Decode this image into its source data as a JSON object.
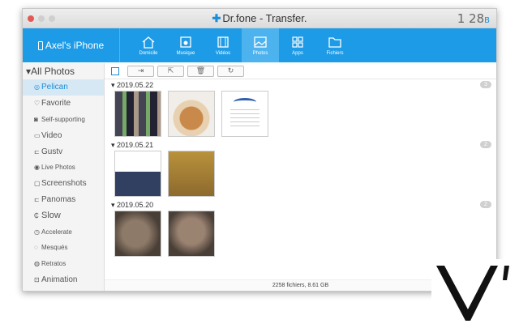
{
  "window": {
    "title": "Dr.fone - Transfer.",
    "counter_main": "1 28",
    "counter_sup": "B",
    "lights": [
      "#e05b56",
      "#cfcfcf",
      "#cfcfcf"
    ]
  },
  "toolbar": {
    "device": "Axel's iPhone",
    "tabs": [
      {
        "label": "Domicile",
        "icon": "home-icon"
      },
      {
        "label": "Musique",
        "icon": "music-icon"
      },
      {
        "label": "Vidéos",
        "icon": "film-icon"
      },
      {
        "label": "Photos",
        "icon": "image-icon"
      },
      {
        "label": "Apps",
        "icon": "apps-icon"
      },
      {
        "label": "Fichiers",
        "icon": "folder-icon"
      }
    ],
    "accent": "#1e9be6"
  },
  "sidebar": {
    "header": "All Photos",
    "items": [
      {
        "label": "Pelican",
        "icon": "camera-icon"
      },
      {
        "label": "Favorite",
        "icon": "heart-icon"
      },
      {
        "label": "Self-supporting",
        "icon": "selfie-icon"
      },
      {
        "label": "Video",
        "icon": "video-icon"
      },
      {
        "label": "Gustv",
        "icon": "burst-icon"
      },
      {
        "label": "Live Photos",
        "icon": "live-icon"
      },
      {
        "label": "Screenshots",
        "icon": "screenshot-icon"
      },
      {
        "label": "Panomas",
        "icon": "panorama-icon"
      },
      {
        "label": "Slow",
        "icon": "slow-icon"
      },
      {
        "label": "Accelerate",
        "icon": "timelapse-icon"
      },
      {
        "label": "Mesqués",
        "icon": "hidden-icon"
      },
      {
        "label": "Retratos",
        "icon": "portrait-icon"
      },
      {
        "label": "Animation",
        "icon": "animation-icon"
      }
    ]
  },
  "actions": [
    "import",
    "export",
    "delete",
    "refresh"
  ],
  "groups": [
    {
      "date": "2019.05.22",
      "count": "3"
    },
    {
      "date": "2019.05.21",
      "count": "2"
    },
    {
      "date": "2019.05.20",
      "count": "2"
    }
  ],
  "status": "2258 fichiers, 8.61 GB"
}
